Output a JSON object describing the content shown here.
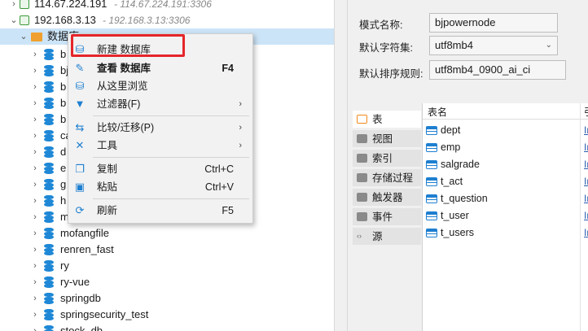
{
  "tree": {
    "connections": [
      {
        "name": "114.67.224.191",
        "host": "- 114.67.224.191:3306"
      },
      {
        "name": "192.168.3.13",
        "host": "- 192.168.3.13:3306"
      }
    ],
    "category": "数据库",
    "databases": [
      "b",
      "bj",
      "b",
      "b",
      "b",
      "ca",
      "d",
      "e",
      "g",
      "h",
      "m",
      "mofangfile",
      "renren_fast",
      "ry",
      "ry-vue",
      "springdb",
      "springsecurity_test",
      "stock_db"
    ]
  },
  "context_menu": {
    "items": [
      {
        "label": "新建 数据库",
        "icon": "database-add-icon"
      },
      {
        "label": "查看 数据库",
        "icon": "pencil-icon",
        "shortcut": "F4"
      },
      {
        "label": "从这里浏览",
        "icon": "browse-icon"
      },
      {
        "label": "过滤器(F)",
        "icon": "filter-icon",
        "submenu": "›"
      },
      {
        "label": "比较/迁移(P)",
        "icon": "compare-icon",
        "submenu": "›"
      },
      {
        "label": "工具",
        "icon": "tools-icon",
        "submenu": "›"
      },
      {
        "label": "复制",
        "icon": "copy-icon",
        "shortcut": "Ctrl+C"
      },
      {
        "label": "粘贴",
        "icon": "paste-icon",
        "shortcut": "Ctrl+V"
      },
      {
        "label": "刷新",
        "icon": "refresh-icon",
        "shortcut": "F5"
      }
    ]
  },
  "properties": {
    "schema_label": "模式名称:",
    "schema_value": "bjpowernode",
    "charset_label": "默认字符集:",
    "charset_value": "utf8mb4",
    "collation_label": "默认排序规则:",
    "collation_value": "utf8mb4_0900_ai_ci"
  },
  "object_tabs": [
    "表",
    "视图",
    "索引",
    "存储过程",
    "触发器",
    "事件",
    "源"
  ],
  "tables": {
    "header_name": "表名",
    "header_other": "引",
    "rows": [
      "dept",
      "emp",
      "salgrade",
      "t_act",
      "t_question",
      "t_user",
      "t_users"
    ],
    "link_text": "In"
  },
  "colors": {
    "accent": "#1e88d6",
    "highlight": "#e5262a",
    "selection": "#cce4f7"
  }
}
